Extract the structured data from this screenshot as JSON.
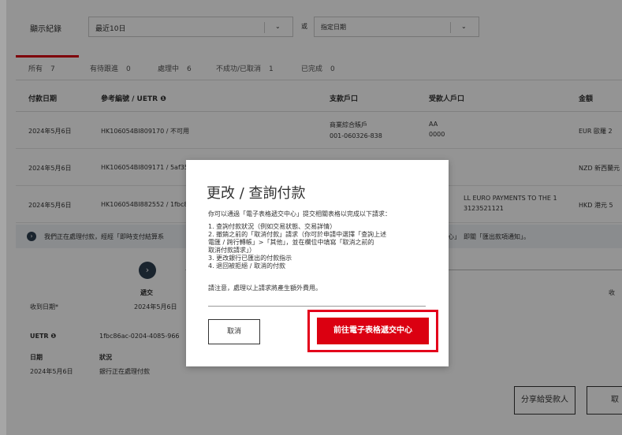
{
  "filter": {
    "label": "顯示紀錄",
    "range_value": "最近10日",
    "or_text": "或",
    "date_placeholder": "指定日期"
  },
  "tabs": [
    {
      "label": "所有",
      "count": "7"
    },
    {
      "label": "有待跟進",
      "count": "0"
    },
    {
      "label": "處理中",
      "count": "6"
    },
    {
      "label": "不成功/已取消",
      "count": "1"
    },
    {
      "label": "已完成",
      "count": "0"
    }
  ],
  "table": {
    "headers": [
      "付款日期",
      "參考編號 / UETR",
      "支款戶口",
      "受款人戶口",
      "金額"
    ],
    "rows": [
      {
        "date": "2024年5月6日",
        "ref": "HK106054BI809170 / 不可用",
        "acct_line1": "商業綜合賬戶",
        "acct_line2": "001-060326-838",
        "bene_line1": "AA",
        "bene_line2": "0000",
        "amount": "EUR 歐羅  2"
      },
      {
        "date": "2024年5月6日",
        "ref": "HK106054BI809171 / 5af35",
        "acct_line1": "",
        "acct_line2": "",
        "bene_line1": "",
        "bene_line2": "",
        "amount": "NZD 新西蘭元"
      },
      {
        "date": "2024年5月6日",
        "ref": "HK106054BI882552 / 1fbc8",
        "acct_line1": "",
        "acct_line2": "",
        "bene_line1": "LL EURO PAYMENTS TO THE 1",
        "bene_line2": "3123521121",
        "amount": "HKD 港元  5"
      }
    ]
  },
  "notice": {
    "text": "我們正在處理付款，經經「即時支付結算系",
    "text_right": "中心」　即關「匯出款項通知」。"
  },
  "detail": {
    "step_label": "遞交",
    "received_label": "收到日期*",
    "received_value": "2024年5月6日",
    "right_label": "收",
    "uetr_label": "UETR",
    "uetr_value": "1fbc86ac-0204-4085-966",
    "date_label": "日期",
    "date_value": "2024年5月6日",
    "status_label": "狀況",
    "status_value": "銀行正在處理付款",
    "share_button": "分享給受款人",
    "second_button": "取"
  },
  "modal": {
    "title": "更改 / 查詢付款",
    "intro": "你可以通過「電子表格遞交中心」提交相關表格以完成以下請求：",
    "items": [
      "1. 查詢付款狀況（例如交易狀態、交易詳情）",
      "2. 撤銷之前的「取消付款」請求（你可於申請中選擇「查詢上述",
      "    電匯 / 跨行轉帳」>「其他」，並在欄位中填寫「取消之前的",
      "    取消付款請求」）",
      "3. 更改銀行已匯出的付款指示",
      "4. 退回被拒絕 / 取消的付款"
    ],
    "note": "請注意，處理以上請求將產生額外費用。",
    "cancel_label": "取消",
    "go_label": "前往電子表格遞交中心"
  },
  "colors": {
    "accent": "#db0011",
    "highlight_outline": "#e3001b",
    "dark_icon": "#2d3e50"
  }
}
